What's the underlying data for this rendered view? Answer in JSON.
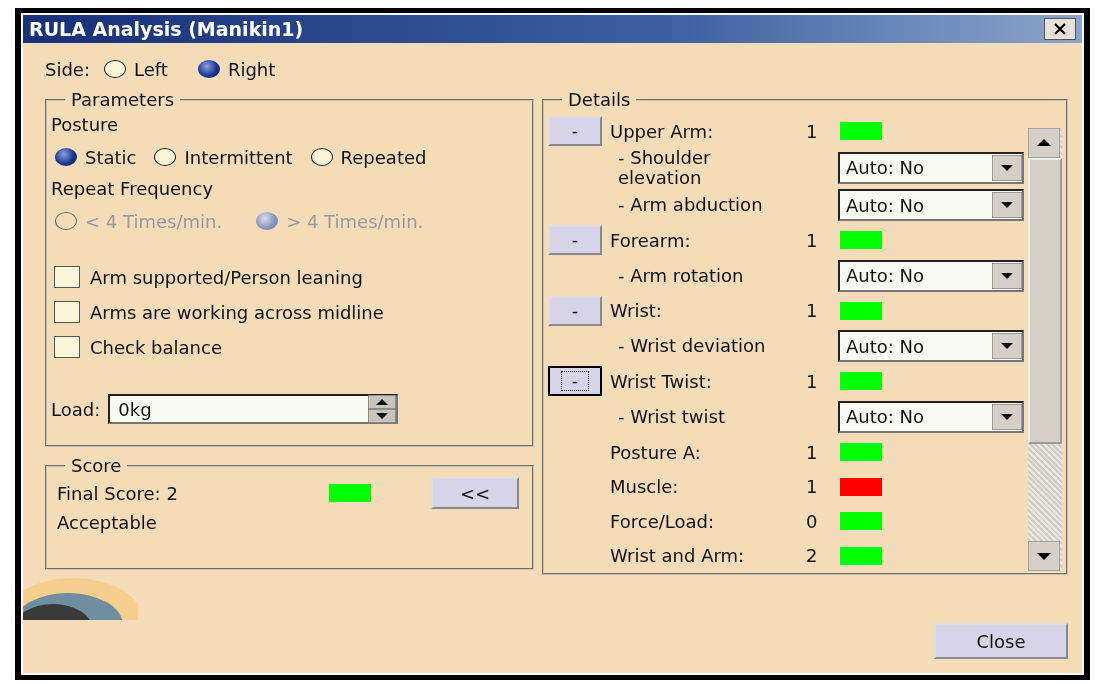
{
  "window": {
    "title": "RULA Analysis (Manikin1)"
  },
  "side": {
    "label": "Side:",
    "options": [
      {
        "label": "Left",
        "selected": false
      },
      {
        "label": "Right",
        "selected": true
      }
    ]
  },
  "parameters": {
    "title": "Parameters",
    "posture": {
      "label": "Posture",
      "options": [
        {
          "label": "Static",
          "selected": true
        },
        {
          "label": "Intermittent",
          "selected": false
        },
        {
          "label": "Repeated",
          "selected": false
        }
      ]
    },
    "repeat_frequency": {
      "label": "Repeat Frequency",
      "disabled": true,
      "options": [
        {
          "label": "< 4 Times/min.",
          "selected": false
        },
        {
          "label": "> 4 Times/min.",
          "selected": true
        }
      ]
    },
    "checkboxes": [
      {
        "label": "Arm supported/Person leaning",
        "checked": false
      },
      {
        "label": "Arms are working across midline",
        "checked": false
      },
      {
        "label": "Check balance",
        "checked": false
      }
    ],
    "load": {
      "label": "Load:",
      "value": "0kg"
    }
  },
  "score": {
    "title": "Score",
    "final_label": "Final Score: 2",
    "color": "#00ff00",
    "verdict": "Acceptable",
    "toggle_button": "<<"
  },
  "details": {
    "title": "Details",
    "rows": [
      {
        "kind": "group",
        "button": "-",
        "focused": false,
        "label": "Upper Arm:",
        "score": "1",
        "color": "#00ff00"
      },
      {
        "kind": "sub",
        "label": "- Shoulder elevation",
        "value": "Auto: No"
      },
      {
        "kind": "sub",
        "label": "- Arm abduction",
        "value": "Auto: No"
      },
      {
        "kind": "group",
        "button": "-",
        "focused": false,
        "label": "Forearm:",
        "score": "1",
        "color": "#00ff00"
      },
      {
        "kind": "sub",
        "label": "- Arm rotation",
        "value": "Auto: No"
      },
      {
        "kind": "group",
        "button": "-",
        "focused": false,
        "label": "Wrist:",
        "score": "1",
        "color": "#00ff00"
      },
      {
        "kind": "sub",
        "label": "- Wrist deviation",
        "value": "Auto: No"
      },
      {
        "kind": "group",
        "button": "-",
        "focused": true,
        "label": "Wrist Twist:",
        "score": "1",
        "color": "#00ff00"
      },
      {
        "kind": "sub",
        "label": "- Wrist twist",
        "value": "Auto: No"
      },
      {
        "kind": "result",
        "label": "Posture A:",
        "score": "1",
        "color": "#00ff00"
      },
      {
        "kind": "result",
        "label": "Muscle:",
        "score": "1",
        "color": "#ff0000"
      },
      {
        "kind": "result",
        "label": "Force/Load:",
        "score": "0",
        "color": "#00ff00"
      },
      {
        "kind": "result",
        "label": "Wrist and Arm:",
        "score": "2",
        "color": "#00ff00"
      }
    ]
  },
  "close_button": "Close"
}
